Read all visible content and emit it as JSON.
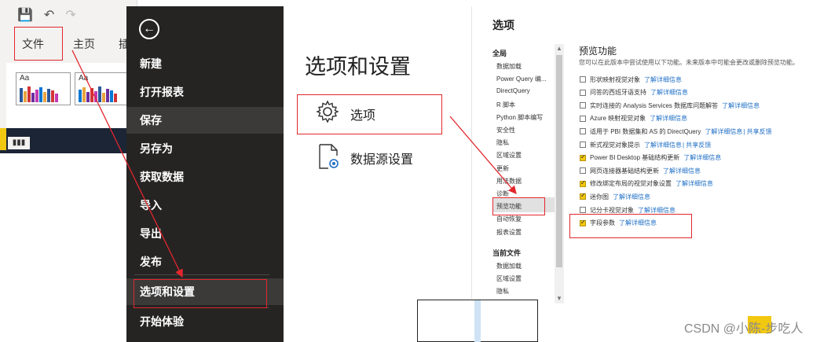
{
  "pbi": {
    "tabs": [
      "文件",
      "主页",
      "插"
    ],
    "thumb_label": "Aa",
    "palette": [
      "#2b579a",
      "#e8a33d",
      "#d13438",
      "#6b2fa0",
      "#c239b3",
      "#0078d4"
    ]
  },
  "backstage": {
    "items": [
      "新建",
      "打开报表",
      "保存",
      "另存为",
      "获取数据",
      "导入",
      "导出",
      "发布",
      "选项和设置",
      "开始体验"
    ]
  },
  "options_panel": {
    "title": "选项和设置",
    "options_label": "选项",
    "datasource_label": "数据源设置"
  },
  "dialog": {
    "title": "选项",
    "global_head": "全局",
    "nav_items": [
      "数据加载",
      "Power Query 编...",
      "DirectQuery",
      "R 脚本",
      "Python 脚本编写",
      "安全性",
      "隐私",
      "区域设置",
      "更新",
      "用法数据",
      "诊断",
      "预览功能",
      "自动恢复",
      "报表设置"
    ],
    "current_head": "当前文件",
    "current_items": [
      "数据加载",
      "区域设置",
      "隐私"
    ],
    "section_title": "预览功能",
    "section_desc": "您可以在此版本中尝试使用以下功能。未来版本中可能会更改或删除预览功能。",
    "learn_more": "了解详细信息",
    "features": [
      {
        "label": "形状映射视觉对象",
        "checked": false,
        "extra": ""
      },
      {
        "label": "问答的西班牙语支持",
        "checked": false,
        "extra": ""
      },
      {
        "label": "实时连接的 Analysis Services 数据库问题解答",
        "checked": false,
        "extra": ""
      },
      {
        "label": "Azure 映射视觉对象",
        "checked": false,
        "extra": ""
      },
      {
        "label": "适用于 PBI 数据集和 AS 的 DirectQuery",
        "checked": false,
        "extra": " | 共享反馈"
      },
      {
        "label": "新式视觉对象提示",
        "checked": false,
        "extra": " | 共享反馈"
      },
      {
        "label": "Power BI Desktop 基础结构更新",
        "checked": true,
        "extra": ""
      },
      {
        "label": "网页连接器基础结构更新",
        "checked": false,
        "extra": ""
      },
      {
        "label": "修改绑定布局的视觉对象设置",
        "checked": true,
        "extra": ""
      },
      {
        "label": "迷你图",
        "checked": true,
        "extra": ""
      },
      {
        "label": "记分卡视觉对象",
        "checked": false,
        "extra": ""
      },
      {
        "label": "字段参数",
        "checked": true,
        "extra": ""
      }
    ]
  },
  "watermark": "CSDN @小陈-步吃人"
}
